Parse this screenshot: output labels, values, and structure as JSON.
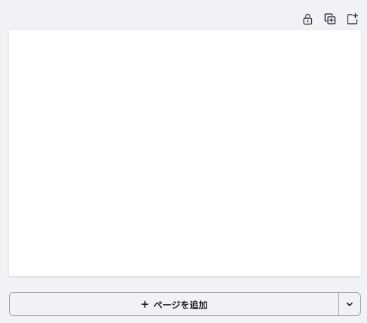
{
  "toolbar": {
    "icons": [
      "unlock-icon",
      "duplicate-page-icon",
      "add-page-icon"
    ]
  },
  "add_page": {
    "plus": "+",
    "label": "ページを追加"
  },
  "dropdown": {
    "icon": "chevron-down-icon"
  },
  "colors": {
    "background": "#f1f2f6",
    "canvas": "#ffffff",
    "border": "#9c9fa8",
    "text": "#1f2128"
  }
}
